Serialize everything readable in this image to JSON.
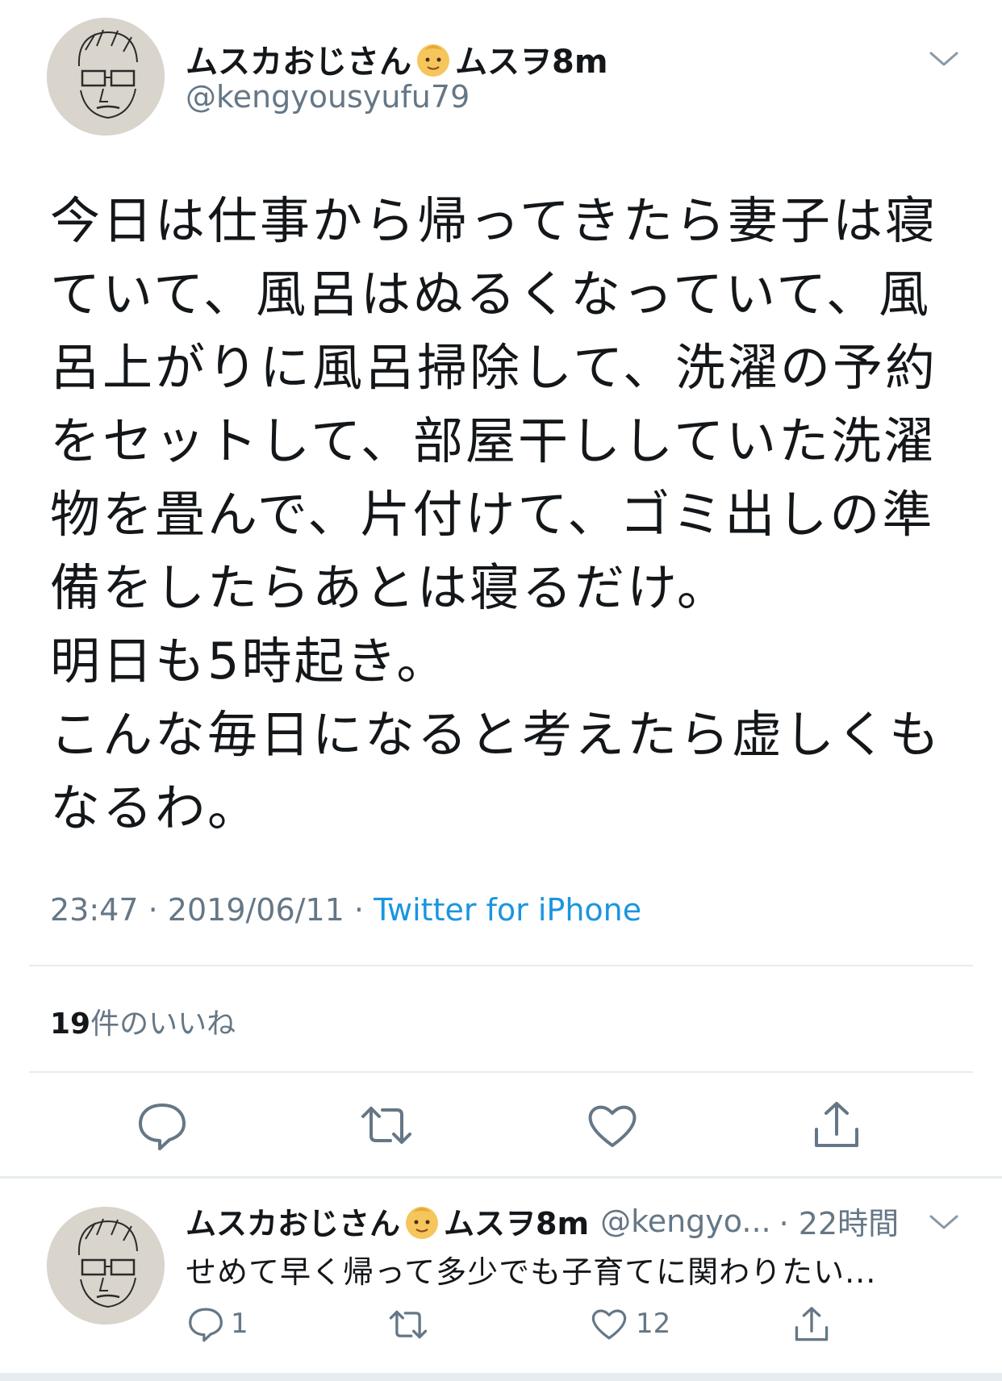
{
  "tweet": {
    "display_name_prefix": "ムスカおじさん",
    "display_name_suffix": "ムスヲ8m",
    "handle": "@kengyousyufu79",
    "text": "今日は仕事から帰ってきたら妻子は寝\nていて、風呂はぬるくなっていて、風\n呂上がりに風呂掃除して、洗濯の予約\nをセットして、部屋干ししていた洗濯\n物を畳んで、片付けて、ゴミ出しの準\n備をしたらあとは寝るだけ。\n明日も5時起き。\nこんな毎日になると考えたら虚しくも\nなるわ。",
    "time": "23:47",
    "date": "2019/06/11",
    "separator": "·",
    "source": "Twitter for iPhone",
    "likes_count": "19",
    "likes_label": "件のいいね"
  },
  "reply": {
    "display_name_prefix": "ムスカおじさん",
    "display_name_suffix": "ムスヲ8m",
    "handle": "@kengyo...",
    "time": "· 22時間",
    "text": "せめて早く帰って多少でも子育てに関わりたい...",
    "reply_count": "1",
    "like_count": "12"
  },
  "icons": {
    "menu": "chevron-down-icon",
    "emoji": "baby-face-icon",
    "reply": "reply-icon",
    "retweet": "retweet-icon",
    "like": "heart-icon",
    "share": "share-icon"
  },
  "colors": {
    "accent": "#1b95e0",
    "secondary_text": "#657786",
    "divider": "#e6ecf0"
  }
}
